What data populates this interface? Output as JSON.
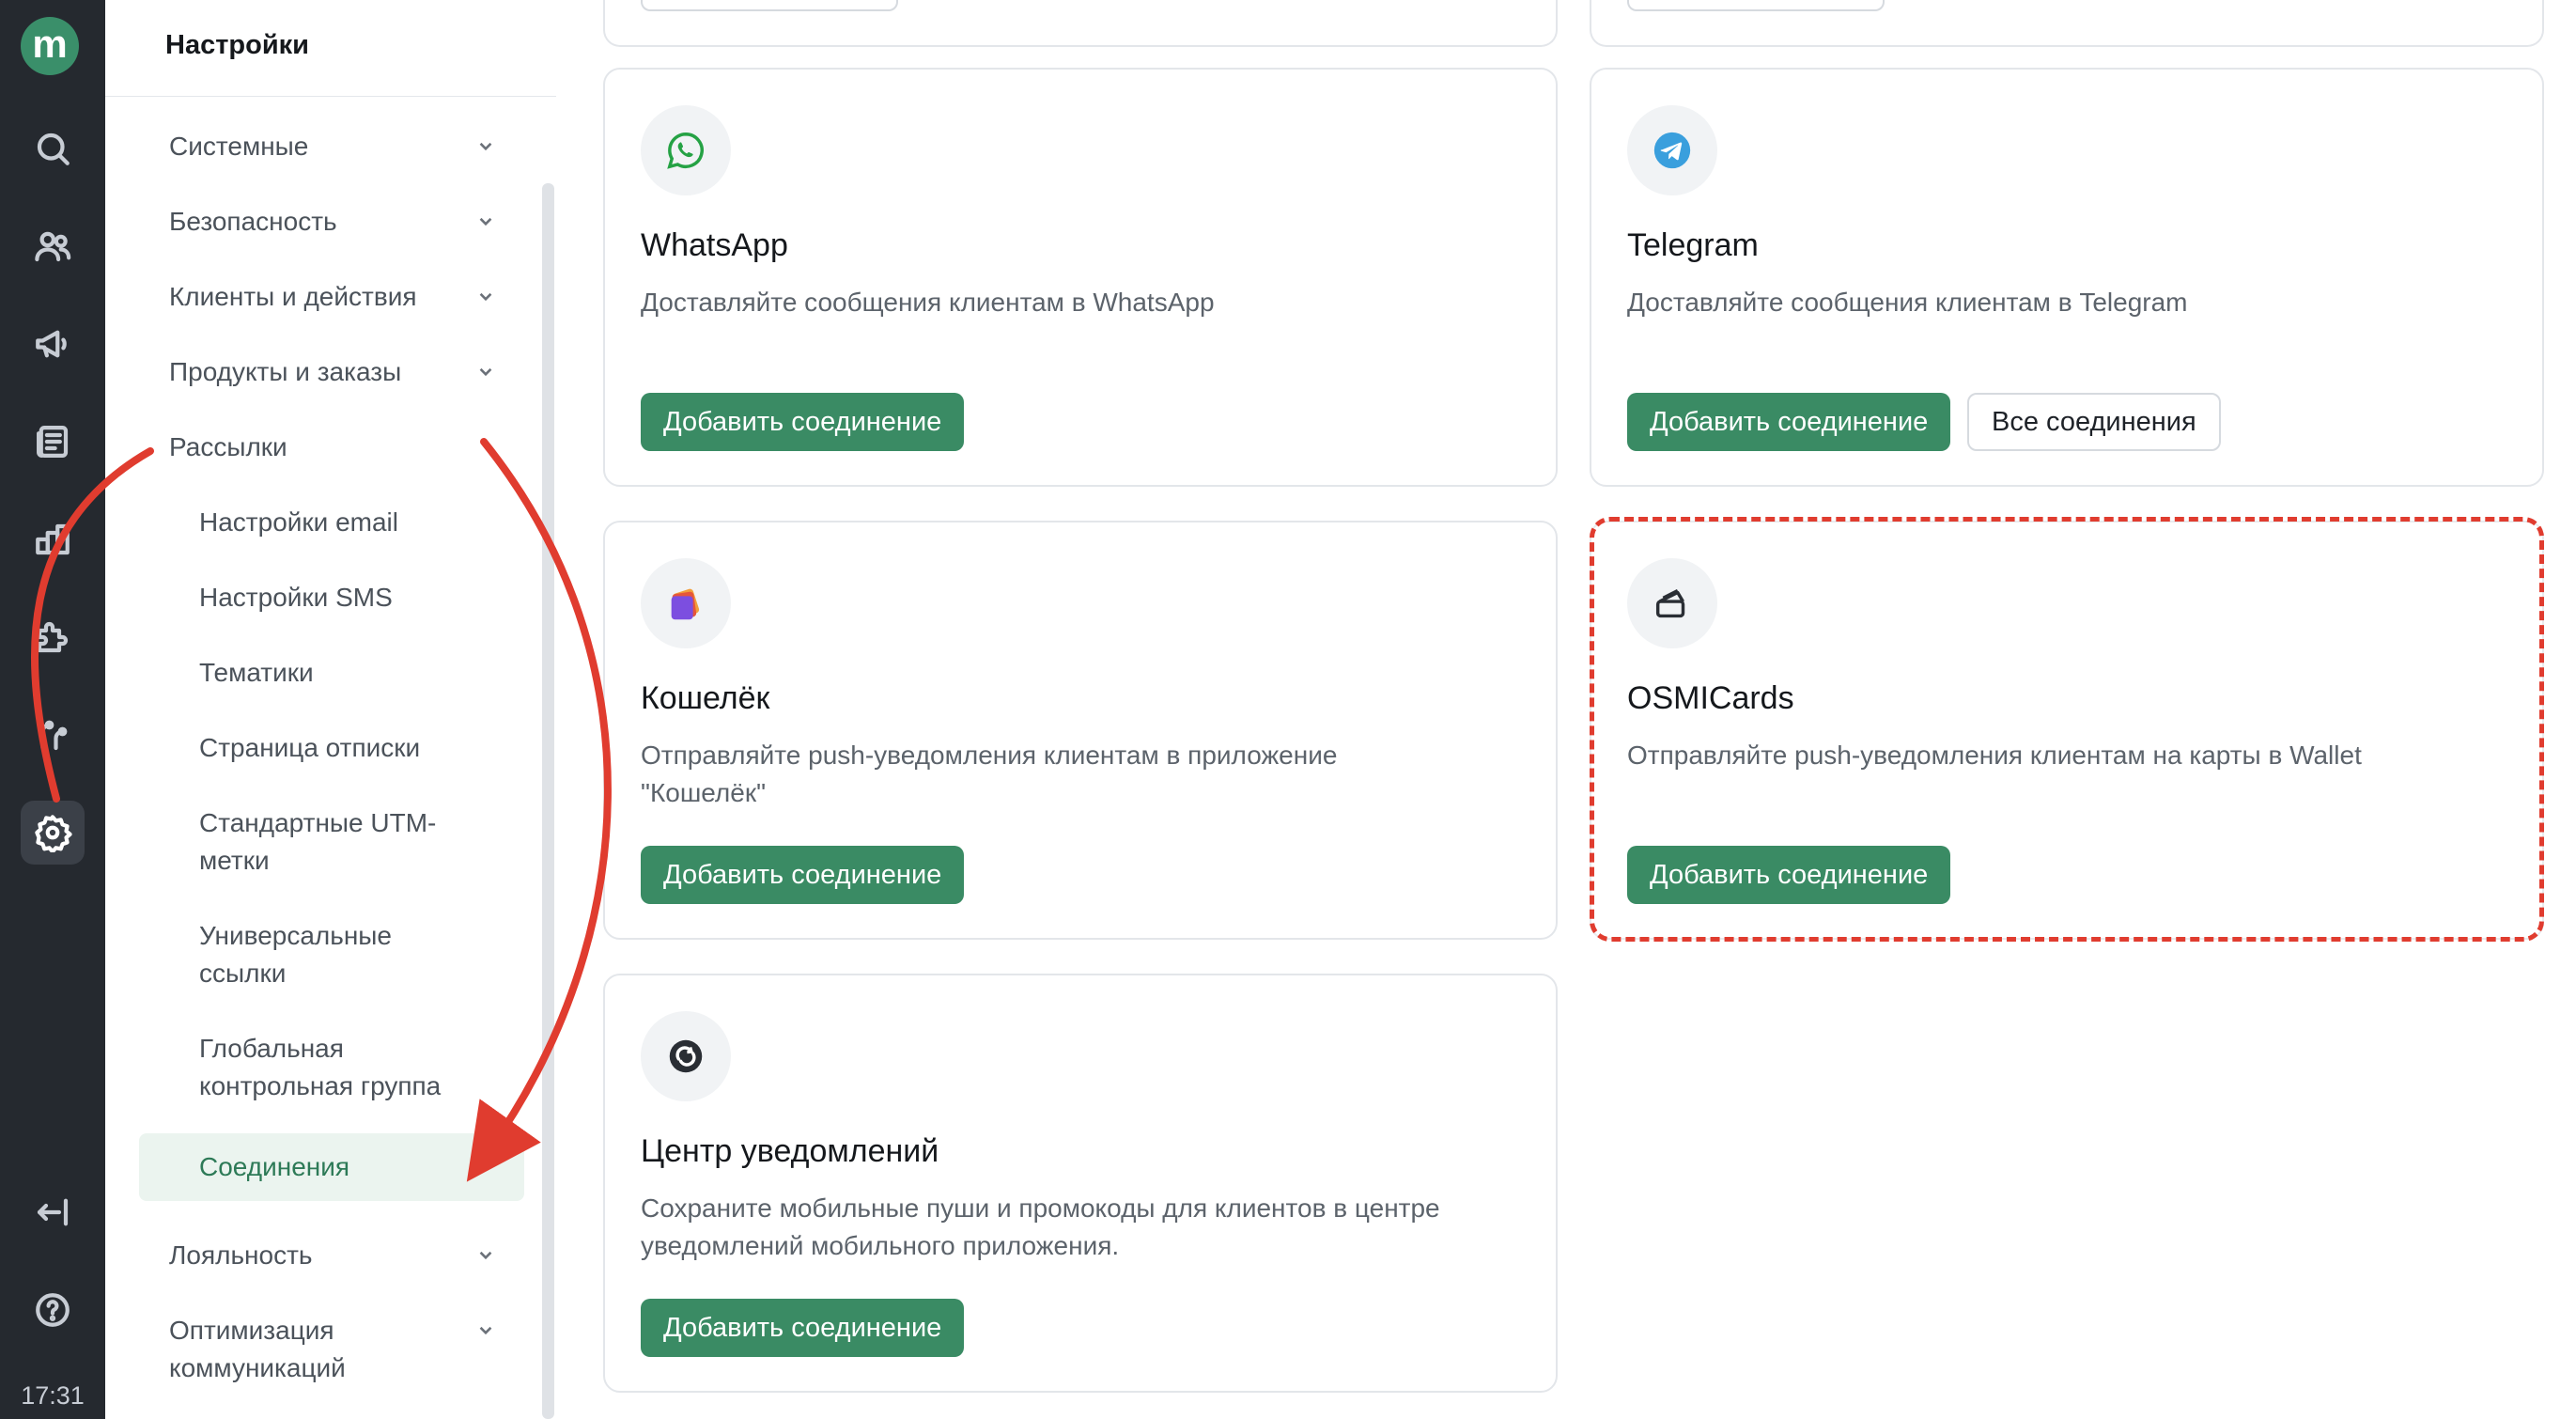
{
  "rail": {
    "logo": "m",
    "time": "17:31",
    "icons": [
      "search-icon",
      "users-icon",
      "megaphone-icon",
      "newsletter-icon",
      "products-icon",
      "puzzle-icon",
      "journey-icon",
      "gear-icon",
      "collapse-icon",
      "help-icon"
    ]
  },
  "sidebar": {
    "title": "Настройки",
    "items": [
      {
        "label": "Системные"
      },
      {
        "label": "Безопасность"
      },
      {
        "label": "Клиенты и действия"
      },
      {
        "label": "Продукты и заказы"
      },
      {
        "label": "Рассылки"
      }
    ],
    "subitems": [
      {
        "label": "Настройки email"
      },
      {
        "label": "Настройки SMS"
      },
      {
        "label": "Тематики"
      },
      {
        "label": "Страница отписки"
      },
      {
        "label": "Стандартные UTM-метки"
      },
      {
        "label": "Универсальные ссылки"
      },
      {
        "label": "Глобальная контрольная группа"
      },
      {
        "label": "Соединения"
      }
    ],
    "bottom_items": [
      {
        "label": "Лояльность"
      },
      {
        "label": "Оптимизация коммуникаций"
      }
    ]
  },
  "cards": [
    {
      "title": "WhatsApp",
      "description": "Доставляйте сообщения клиентам в WhatsApp",
      "primary": "Добавить соединение"
    },
    {
      "title": "Telegram",
      "description": "Доставляйте сообщения клиентам в Telegram",
      "primary": "Добавить соединение",
      "secondary": "Все соединения"
    },
    {
      "title": "Кошелёк",
      "description": "Отправляйте push-уведомления клиентам в приложение \"Кошелёк\"",
      "primary": "Добавить соединение"
    },
    {
      "title": "OSMICards",
      "description": "Отправляйте push-уведомления клиентам на карты в Wallet",
      "primary": "Добавить соединение"
    },
    {
      "title": "Центр уведомлений",
      "description": "Сохраните мобильные пуши и промокоды для клиентов в центре уведомлений мобильного приложения.",
      "primary": "Добавить соединение"
    }
  ],
  "colors": {
    "accent": "#3a8b64",
    "rail_bg": "#25292f",
    "annotation": "#e03c2f",
    "active_bg": "#ebf4ef"
  }
}
